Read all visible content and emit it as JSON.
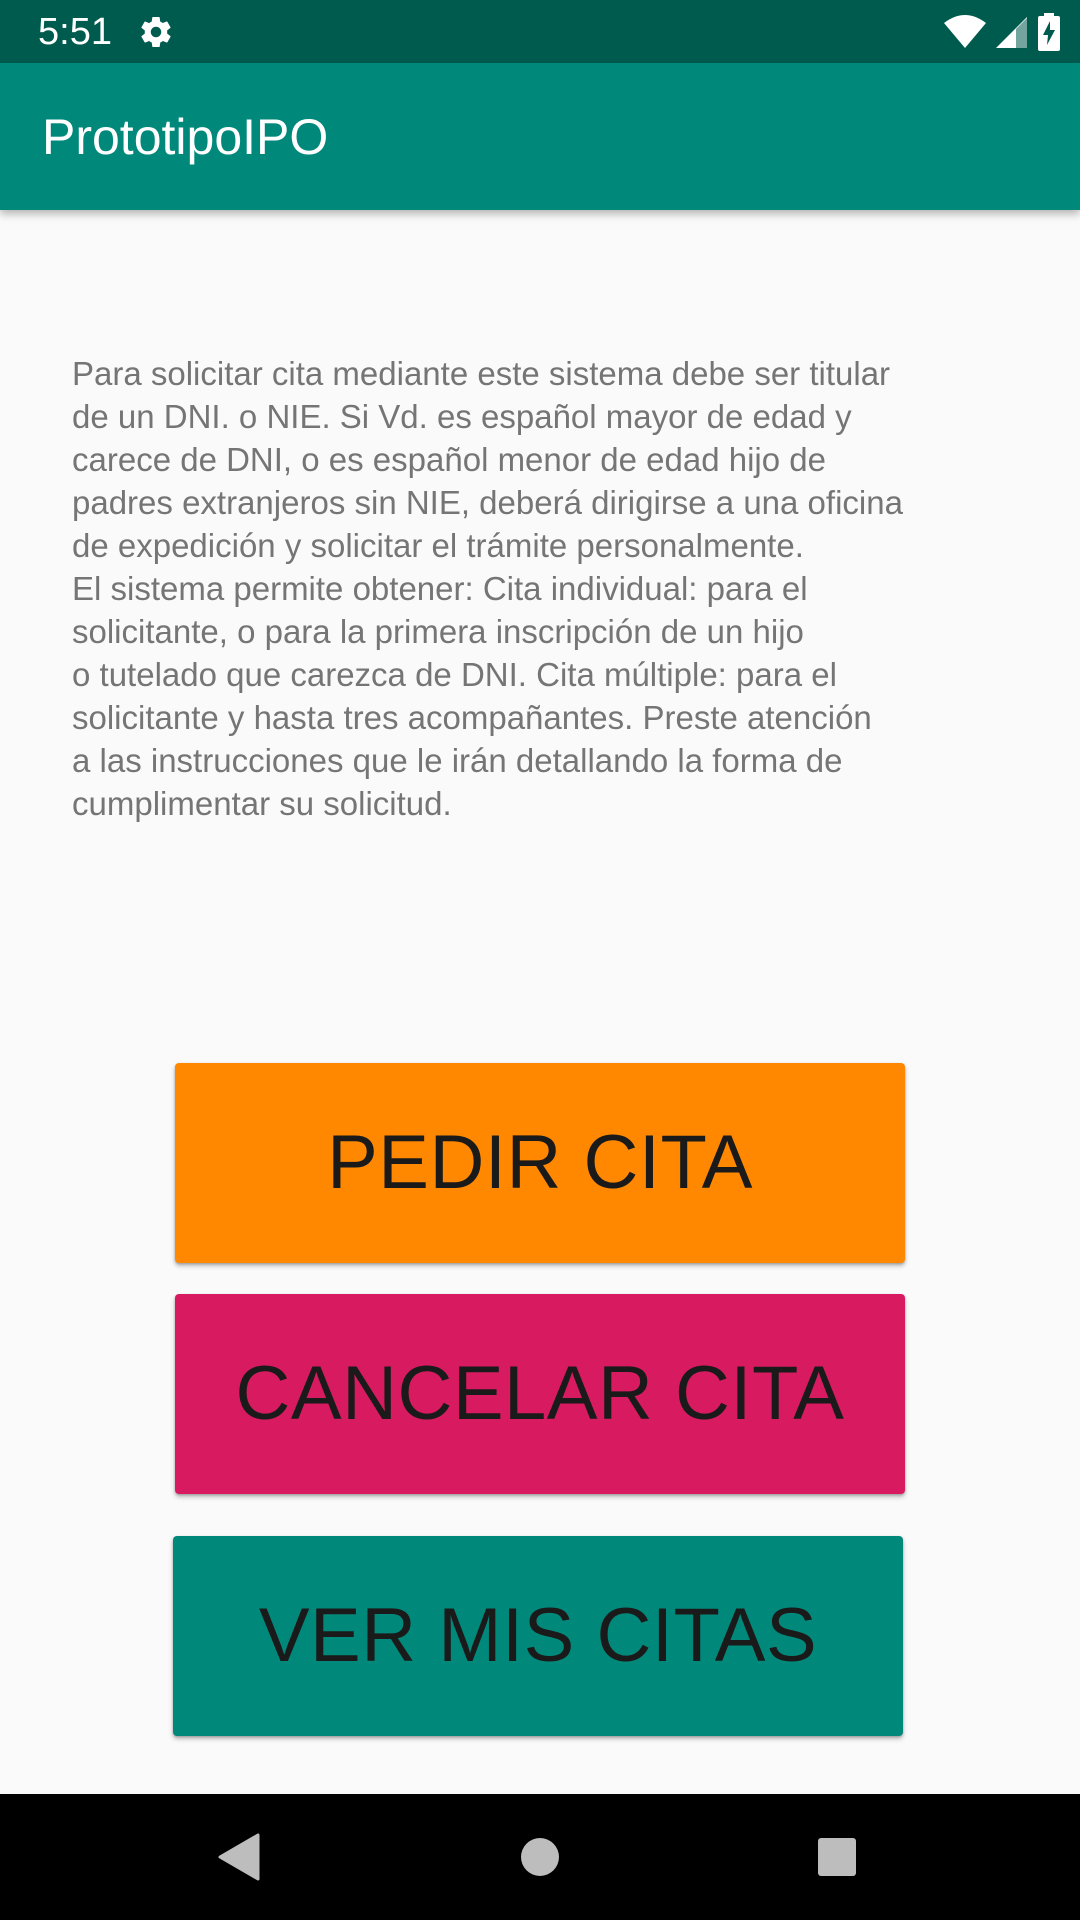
{
  "status_bar": {
    "time": "5:51",
    "icons": [
      "settings-gear-icon",
      "wifi-icon",
      "cell-signal-icon",
      "battery-charging-icon"
    ],
    "background": "#005b4f"
  },
  "app_bar": {
    "title": "PrototipoIPO",
    "background": "#00897b"
  },
  "main": {
    "description": "Para solicitar cita mediante este sistema debe ser titular\nde un DNI. o NIE.  Si Vd. es español mayor de edad y\ncarece de DNI, o es español menor de edad hijo de\npadres extranjeros sin NIE, deberá dirigirse a una oficina\nde expedición y solicitar el trámite personalmente.\nEl sistema permite obtener: Cita individual: para el\nsolicitante, o para la primera inscripción de un hijo\no tutelado que carezca de DNI. Cita múltiple: para el\nsolicitante y hasta tres acompañantes.  Preste atención\na las instrucciones que le irán detallando la forma de\ncumplimentar su solicitud.",
    "buttons": {
      "pedir_cita": {
        "label": "PEDIR CITA",
        "color": "#ff8800"
      },
      "cancelar_cita": {
        "label": "CANCELAR CITA",
        "color": "#d81b60"
      },
      "ver_mis_citas": {
        "label": "VER MIS CITAS",
        "color": "#00897b"
      }
    }
  },
  "nav_bar": {
    "items": [
      "back-icon",
      "home-icon",
      "recents-icon"
    ]
  }
}
